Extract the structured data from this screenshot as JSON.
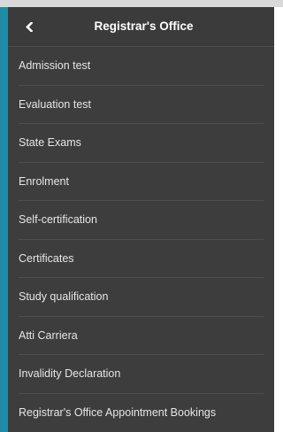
{
  "header": {
    "title": "Registrar's Office",
    "back_icon": "chevron-left-icon"
  },
  "menu": {
    "items": [
      {
        "label": "Admission test"
      },
      {
        "label": "Evaluation test"
      },
      {
        "label": "State Exams"
      },
      {
        "label": "Enrolment"
      },
      {
        "label": "Self-certification"
      },
      {
        "label": "Certificates"
      },
      {
        "label": "Study qualification"
      },
      {
        "label": "Atti Carriera"
      },
      {
        "label": "Invalidity Declaration"
      },
      {
        "label": "Registrar's Office Appointment Bookings"
      }
    ]
  },
  "colors": {
    "panel_background": "#3d3d3d",
    "accent_bar": "#1f8ca6",
    "text": "#e6e6e6",
    "divider": "#4e4e4e"
  }
}
